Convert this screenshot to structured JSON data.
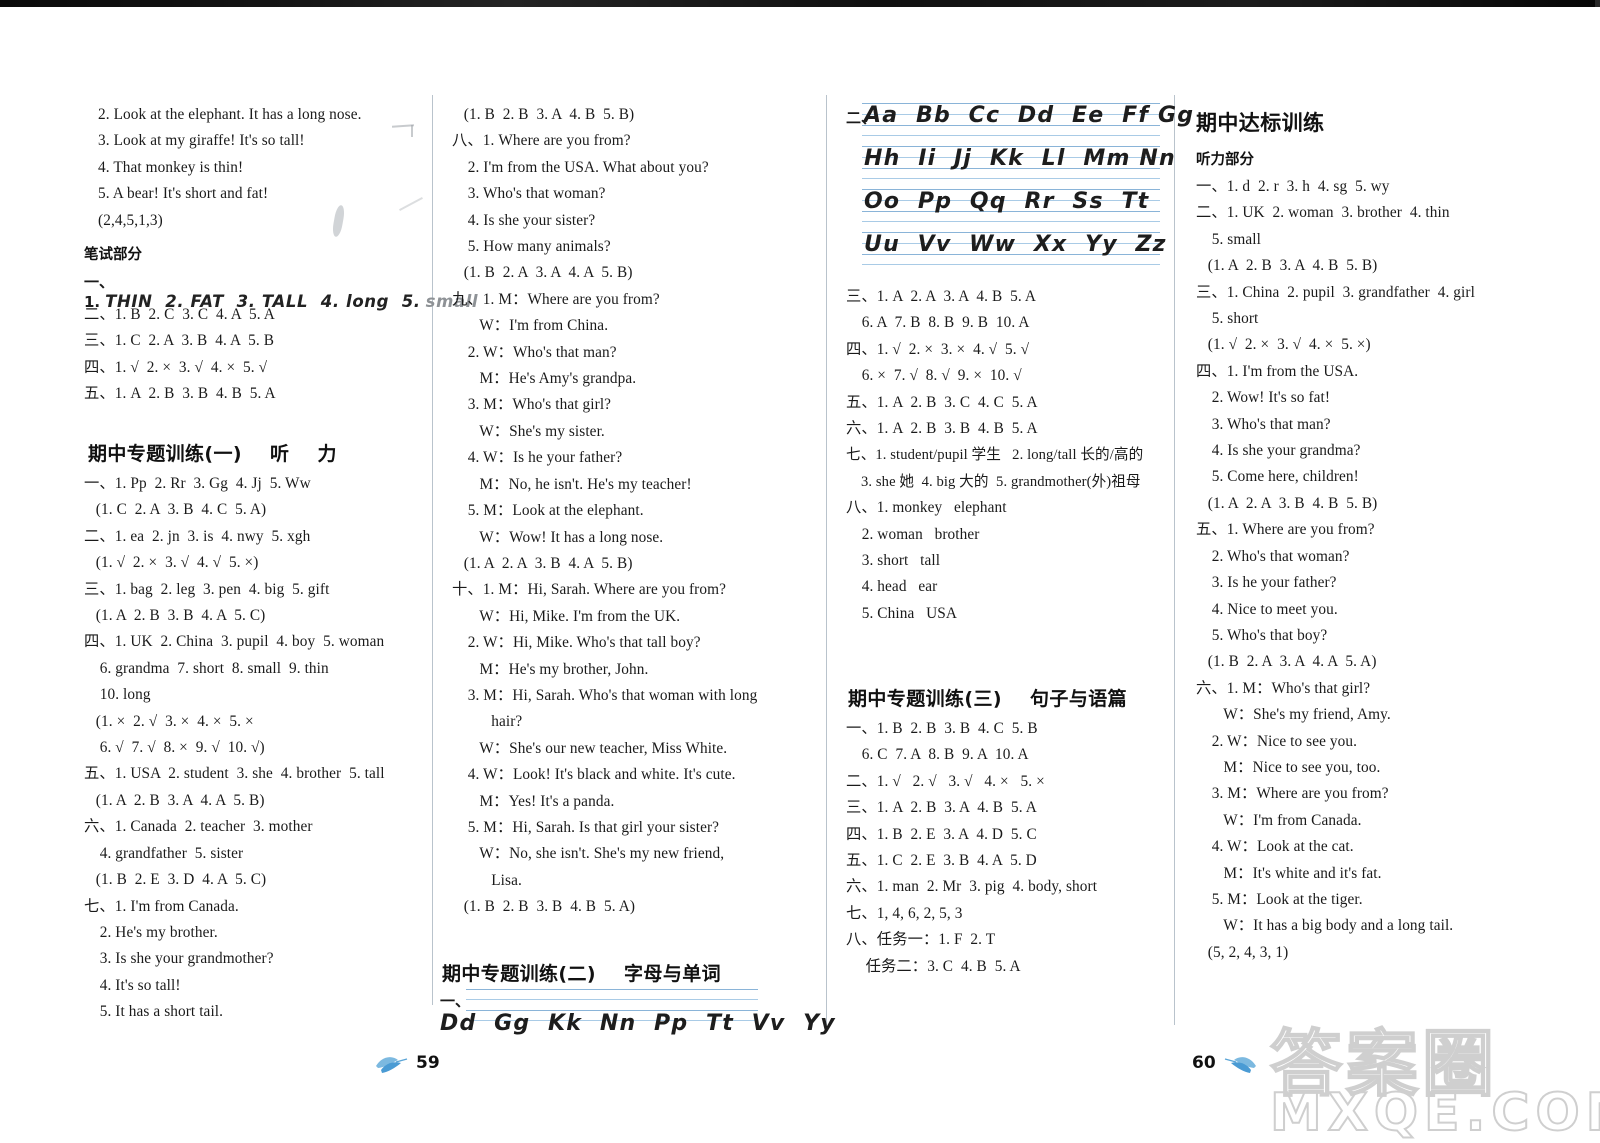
{
  "document": {
    "type": "answer-key-page",
    "left_page_number": "59",
    "right_page_number": "60",
    "watermark_cn": "答案圈",
    "watermark_en": "MXQE.COM"
  },
  "col1": {
    "listening_tail": [
      "2. Look at the elephant. It has a long nose.",
      "3. Look at my giraffe! It's so tall!",
      "4. That monkey is thin!",
      "5. A bear! It's short and fat!",
      "(2,4,5,1,3)"
    ],
    "written_heading": "笔试部分",
    "written_answers": [
      "二、1. B  2. C  3. C  4. A  5. A",
      "三、1. C  2. A  3. B  4. A  5. B",
      "四、1. √  2. ×  3. √  4. ×  5. √",
      "五、1. A  2. B  3. B  4. B  5. A"
    ],
    "hw_line_prefix": "一、1.",
    "hw_words": "THIN  2. FAT  3. TALL  4. long  5.",
    "hw_faded": "small",
    "section_title": "期中专题训练(一)    听    力",
    "section_body": [
      "一、1. Pp  2. Rr  3. Gg  4. Jj  5. Ww",
      "   (1. C  2. A  3. B  4. C  5. A)",
      "二、1. ea  2. jn  3. is  4. nwy  5. xgh",
      "   (1. √  2. ×  3. √  4. √  5. ×)",
      "三、1. bag  2. leg  3. pen  4. big  5. gift",
      "   (1. A  2. B  3. B  4. A  5. C)",
      "四、1. UK  2. China  3. pupil  4. boy  5. woman",
      "    6. grandma  7. short  8. small  9. thin",
      "    10. long",
      "   (1. ×  2. √  3. ×  4. ×  5. ×",
      "    6. √  7. √  8. ×  9. √  10. √)",
      "五、1. USA  2. student  3. she  4. brother  5. tall",
      "   (1. A  2. B  3. A  4. A  5. B)",
      "六、1. Canada  2. teacher  3. mother",
      "    4. grandfather  5. sister",
      "   (1. B  2. E  3. D  4. A  5. C)",
      "七、1. I'm from Canada.",
      "    2. He's my brother.",
      "    3. Is she your grandmother?",
      "    4. It's so tall!",
      "    5. It has a short tail."
    ]
  },
  "col2": {
    "body": [
      "   (1. B  2. B  3. A  4. B  5. B)",
      "八、1. Where are you from?",
      "    2. I'm from the USA. What about you?",
      "    3. Who's that woman?",
      "    4. Is she your sister?",
      "    5. How many animals?",
      "   (1. B  2. A  3. A  4. A  5. B)",
      "九、1. M：Where are you from?",
      "       W：I'm from China.",
      "    2. W：Who's that man?",
      "       M：He's Amy's grandpa.",
      "    3. M：Who's that girl?",
      "       W：She's my sister.",
      "    4. W：Is he your father?",
      "       M：No, he isn't. He's my teacher!",
      "    5. M：Look at the elephant.",
      "       W：Wow! It has a long nose.",
      "   (1. A  2. A  3. B  4. A  5. B)",
      "十、1. M：Hi, Sarah. Where are you from?",
      "       W：Hi, Mike. I'm from the UK.",
      "    2. W：Hi, Mike. Who's that tall boy?",
      "       M：He's my brother, John.",
      "    3. M：Hi, Sarah. Who's that woman with long",
      "          hair?",
      "       W：She's our new teacher, Miss White.",
      "    4. W：Look! It's black and white. It's cute.",
      "       M：Yes! It's a panda.",
      "    5. M：Hi, Sarah. Is that girl your sister?",
      "       W：No, she isn't. She's my new friend,",
      "          Lisa.",
      "   (1. B  2. B  3. B  4. B  5. A)"
    ],
    "section_title": "期中专题训练(二)    字母与单词",
    "hw_prefix": "一、",
    "hw_letters": "Dd  Gg  Kk  Nn  Pp  Tt  Vv  Yy"
  },
  "col3": {
    "hw_prefix": "二、",
    "hw_rows": [
      "Aa  Bb  Cc  Dd  Ee  Ff Gg",
      "Hh  Ii  Jj  Kk  Ll  Mm Nn",
      "Oo  Pp  Qq  Rr  Ss  Tt",
      "Uu  Vv  Ww  Xx  Yy  Zz"
    ],
    "body": [
      "三、1. A  2. A  3. A  4. B  5. A",
      "    6. A  7. B  8. B  9. B  10. A",
      "四、1. √  2. ×  3. ×  4. √  5. √",
      "    6. ×  7. √  8. √  9. ×  10. √",
      "五、1. A  2. B  3. C  4. C  5. A",
      "六、1. A  2. B  3. B  4. B  5. A",
      "七、1. student/pupil 学生   2. long/tall 长的/高的",
      "    3. she 她  4. big 大的  5. grandmother(外)祖母",
      "八、1. monkey   elephant",
      "    2. woman   brother",
      "    3. short   tall",
      "    4. head   ear",
      "    5. China   USA"
    ],
    "section_title": "期中专题训练(三)    句子与语篇",
    "section_body": [
      "一、1. B  2. B  3. B  4. C  5. B",
      "    6. C  7. A  8. B  9. A  10. A",
      "二、1. √   2. √   3. √   4. ×   5. ×",
      "三、1. A  2. B  3. A  4. B  5. A",
      "四、1. B  2. E  3. A  4. D  5. C",
      "五、1. C  2. E  3. B  4. A  5. D",
      "六、1. man  2. Mr  3. pig  4. body, short",
      "七、1, 4, 6, 2, 5, 3",
      "八、任务一：1. F  2. T",
      "     任务二：3. C  4. B  5. A"
    ]
  },
  "col4": {
    "section_title": "期中达标训练",
    "subhead": "听力部分",
    "body": [
      "一、1. d  2. r  3. h  4. sg  5. wy",
      "二、1. UK  2. woman  3. brother  4. thin",
      "    5. small",
      "   (1. A  2. B  3. A  4. B  5. B)",
      "三、1. China  2. pupil  3. grandfather  4. girl",
      "    5. short",
      "   (1. √  2. ×  3. √  4. ×  5. ×)",
      "四、1. I'm from the USA.",
      "    2. Wow! It's so fat!",
      "    3. Who's that man?",
      "    4. Is she your grandma?",
      "    5. Come here, children!",
      "   (1. A  2. A  3. B  4. B  5. B)",
      "五、1. Where are you from?",
      "    2. Who's that woman?",
      "    3. Is he your father?",
      "    4. Nice to meet you.",
      "    5. Who's that boy?",
      "   (1. B  2. A  3. A  4. A  5. A)",
      "六、1. M：Who's that girl?",
      "       W：She's my friend, Amy.",
      "    2. W：Nice to see you.",
      "       M：Nice to see you, too.",
      "    3. M：Where are you from?",
      "       W：I'm from Canada.",
      "    4. W：Look at the cat.",
      "       M：It's white and it's fat.",
      "    5. M：Look at the tiger.",
      "       W：It has a big body and a long tail.",
      "   (5, 2, 4, 3, 1)"
    ]
  }
}
